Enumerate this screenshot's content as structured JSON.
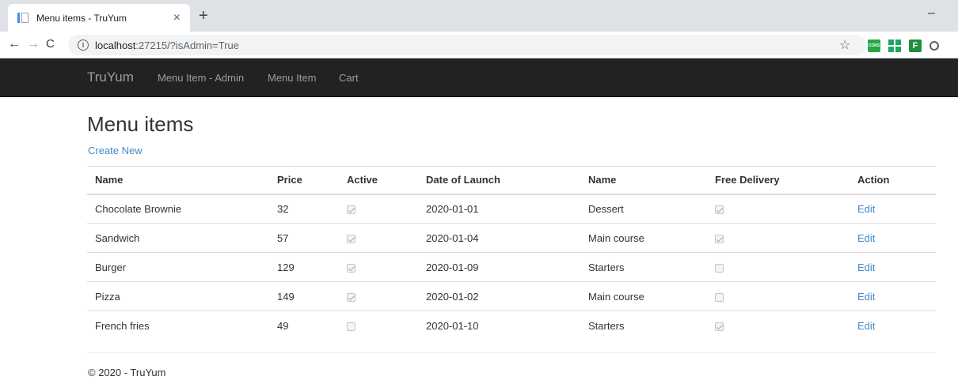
{
  "browser": {
    "tab_title": "Menu items - TruYum",
    "tab_close": "×",
    "new_tab": "+",
    "minimize": "–",
    "url_host": "localhost",
    "url_rest": ":27215/?isAdmin=True",
    "ext_cors_label": "CORS",
    "ext_f_label": "F"
  },
  "navbar": {
    "brand": "TruYum",
    "links": [
      "Menu Item - Admin",
      "Menu Item",
      "Cart"
    ]
  },
  "page": {
    "title": "Menu items",
    "create_new": "Create New"
  },
  "table": {
    "headers": [
      "Name",
      "Price",
      "Active",
      "Date of Launch",
      "Name",
      "Free Delivery",
      "Action"
    ],
    "rows": [
      {
        "name": "Chocolate Brownie",
        "price": "32",
        "active": true,
        "date": "2020-01-01",
        "category": "Dessert",
        "free_delivery": true,
        "action": "Edit"
      },
      {
        "name": "Sandwich",
        "price": "57",
        "active": true,
        "date": "2020-01-04",
        "category": "Main course",
        "free_delivery": true,
        "action": "Edit"
      },
      {
        "name": "Burger",
        "price": "129",
        "active": true,
        "date": "2020-01-09",
        "category": "Starters",
        "free_delivery": false,
        "action": "Edit"
      },
      {
        "name": "Pizza",
        "price": "149",
        "active": true,
        "date": "2020-01-02",
        "category": "Main course",
        "free_delivery": false,
        "action": "Edit"
      },
      {
        "name": "French fries",
        "price": "49",
        "active": false,
        "date": "2020-01-10",
        "category": "Starters",
        "free_delivery": true,
        "action": "Edit"
      }
    ]
  },
  "footer": {
    "text": "© 2020 - TruYum"
  },
  "colors": {
    "navbar_bg": "#222222",
    "link": "#428bca",
    "nav_text": "#9d9d9d"
  }
}
